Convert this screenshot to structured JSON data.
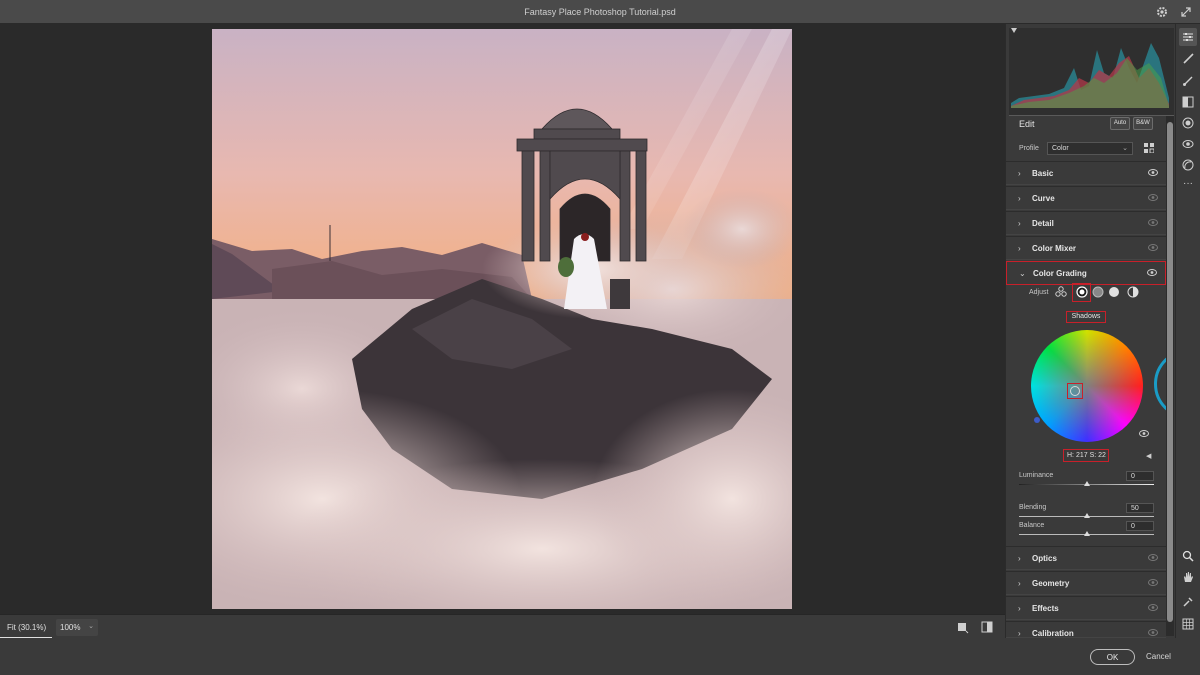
{
  "window": {
    "title": "Fantasy Place Photoshop Tutorial.psd"
  },
  "statusbar": {
    "zoom_fit": "Fit (30.1%)",
    "zoom_value": "100%"
  },
  "footer": {
    "ok": "OK",
    "cancel": "Cancel"
  },
  "edit": {
    "label": "Edit",
    "auto": "Auto",
    "bw": "B&W",
    "profile_label": "Profile",
    "profile_value": "Color"
  },
  "sections": [
    {
      "name": "Basic"
    },
    {
      "name": "Curve"
    },
    {
      "name": "Detail"
    },
    {
      "name": "Color Mixer"
    },
    {
      "name": "Color Grading"
    },
    {
      "name": "Optics"
    },
    {
      "name": "Geometry"
    },
    {
      "name": "Effects"
    },
    {
      "name": "Calibration"
    }
  ],
  "color_grading": {
    "adjust_label": "Adjust",
    "selected_tab": "Shadows",
    "hue_saturation": "H: 217 S: 22",
    "luminance_label": "Luminance",
    "luminance_value": "0",
    "blending_label": "Blending",
    "blending_value": "50",
    "balance_label": "Balance",
    "balance_value": "0",
    "levels": {
      "luminance": 0.5,
      "blending": 0.5,
      "balance": 0.5
    }
  },
  "icons": {
    "titlebar": [
      "gear-icon",
      "expand-icon"
    ],
    "tools": [
      "sliders-icon",
      "brush-icon",
      "pen-icon",
      "gradient-icon",
      "radial-icon",
      "eye-icon",
      "mask-icon",
      "more-icon",
      "zoom-icon",
      "hand-icon",
      "eyedropper-icon",
      "grid-icon"
    ]
  },
  "colors": {
    "accent_red": "#c8202a",
    "panel": "#3a3a3a",
    "canvas_bg": "#2a2a2a"
  }
}
